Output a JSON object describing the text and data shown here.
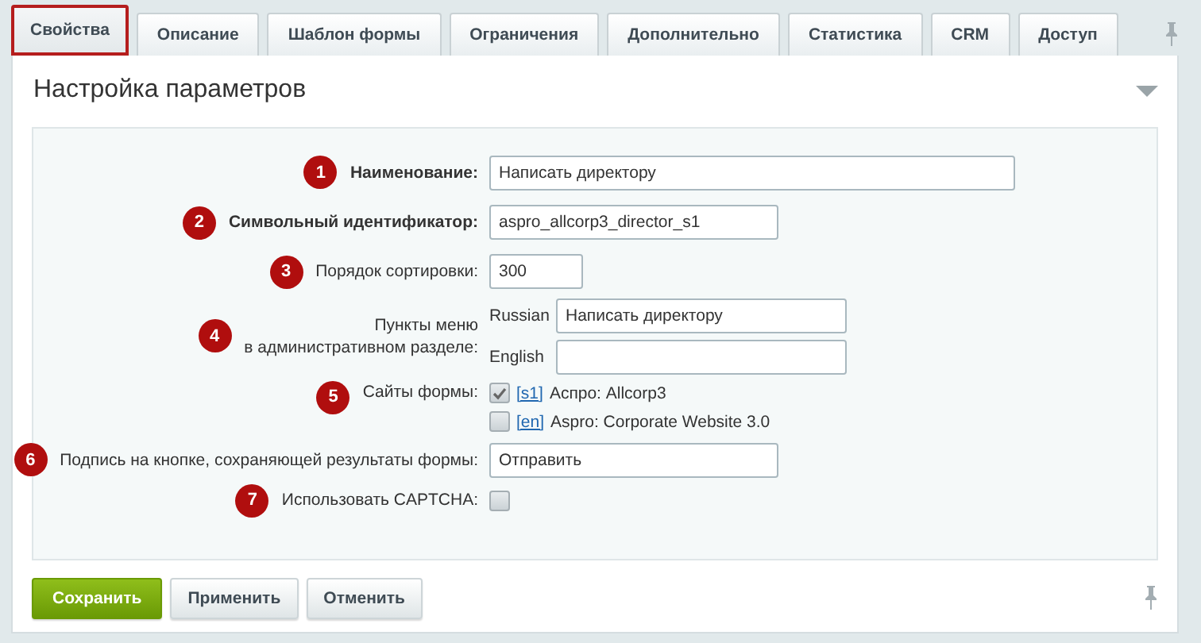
{
  "tabs": [
    {
      "label": "Свойства",
      "selected": true
    },
    {
      "label": "Описание",
      "selected": false
    },
    {
      "label": "Шаблон формы",
      "selected": false
    },
    {
      "label": "Ограничения",
      "selected": false
    },
    {
      "label": "Дополнительно",
      "selected": false
    },
    {
      "label": "Статистика",
      "selected": false
    },
    {
      "label": "CRM",
      "selected": false
    },
    {
      "label": "Доступ",
      "selected": false
    }
  ],
  "section": {
    "title": "Настройка параметров"
  },
  "fields": [
    {
      "badge": "1",
      "label": "Наименование:",
      "required": true,
      "kind": "text",
      "value": "Написать директору"
    },
    {
      "badge": "2",
      "label": "Символьный идентификатор:",
      "required": true,
      "kind": "text",
      "value": "aspro_allcorp3_director_s1"
    },
    {
      "badge": "3",
      "label": "Порядок сортировки:",
      "required": false,
      "kind": "text",
      "value": "300"
    },
    {
      "badge": "4",
      "label": "Пункты меню",
      "label_2": "в административном разделе:",
      "required": false,
      "kind": "languages",
      "languages": [
        {
          "lang": "Russian",
          "value": "Написать директору"
        },
        {
          "lang": "English"
        }
      ]
    },
    {
      "badge": "5",
      "label": "Сайты формы:",
      "required": false,
      "kind": "sites",
      "sites": [
        {
          "code": "[s1]",
          "name": "Аспро: Allcorp3",
          "checked": true
        },
        {
          "code": "[en]",
          "name": "Aspro: Corporate Website 3.0",
          "checked": false
        }
      ]
    },
    {
      "badge": "6",
      "label": "Подпись на кнопке, сохраняющей результаты формы:",
      "required": false,
      "kind": "text",
      "value": "Отправить"
    },
    {
      "badge": "7",
      "label": "Использовать CAPTCHA:",
      "required": false,
      "kind": "checkbox",
      "checked": false
    }
  ],
  "buttons": [
    {
      "label": "Сохранить",
      "kind": "primary"
    },
    {
      "label": "Применить",
      "kind": "normal"
    },
    {
      "label": "Отменить",
      "kind": "normal"
    }
  ]
}
